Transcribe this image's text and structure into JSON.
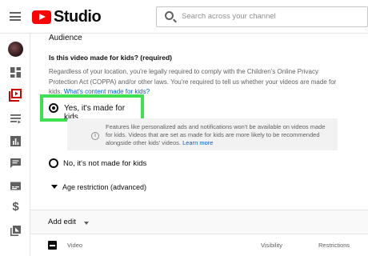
{
  "header": {
    "logo_text": "Studio",
    "search_placeholder": "Search across your channel"
  },
  "rail": {
    "items": [
      "avatar",
      "dashboard-icon",
      "content-icon",
      "playlists-icon",
      "analytics-icon",
      "comments-icon",
      "subtitles-icon",
      "dollar-icon",
      "library-icon"
    ],
    "dollar_glyph": "$"
  },
  "main": {
    "section_title": "Audience",
    "question": "Is this video made for kids? (required)",
    "description": "Regardless of your location, you're legally required to comply with the Children's Online Privacy Protection Act (COPPA) and/or other laws. You're required to tell us whether your videos are made for kids.",
    "description_link": "What's content made for kids?",
    "option_yes": "Yes, it's made for kids",
    "notice_text": "Features like personalized ads and notifications won't be available on videos made for kids. Videos that are set as made for kids are more likely to be recommended alongside other kids' videos.",
    "notice_link": "Learn more",
    "option_no": "No, it's not made for kids",
    "age_restriction": "Age restriction (advanced)",
    "selected": "yes"
  },
  "edit_bar": {
    "add_edit_label": "Add edit"
  },
  "table": {
    "columns": [
      "Video",
      "Visibility",
      "Restrictions"
    ]
  },
  "colors": {
    "highlight": "#3ee052",
    "brand_red": "#ff0000",
    "link": "#065fd4"
  }
}
